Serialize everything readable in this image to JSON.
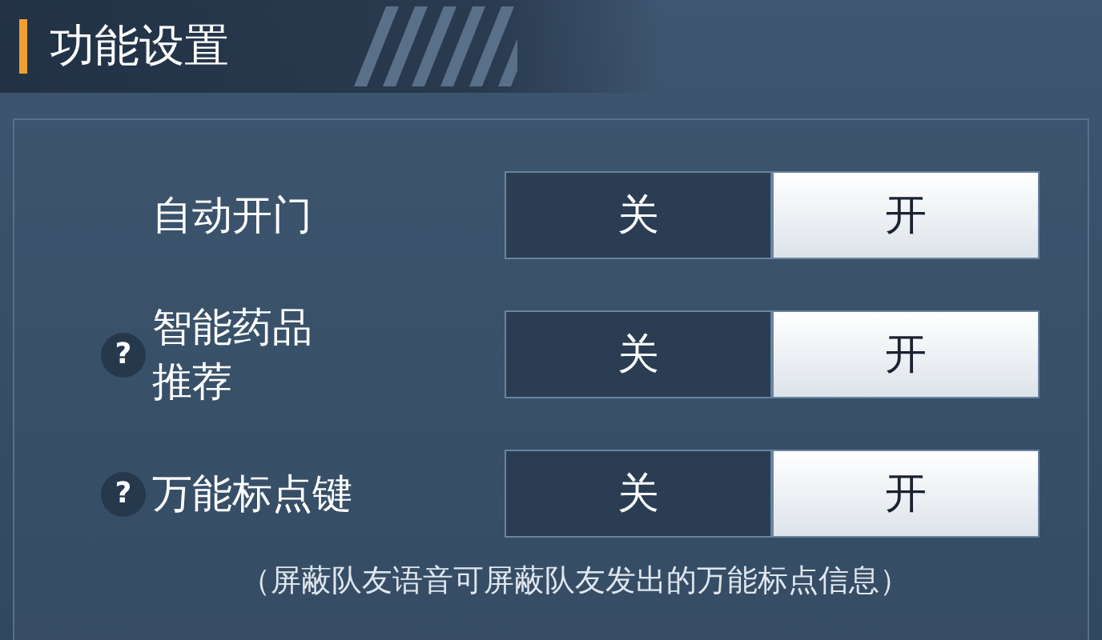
{
  "title": "功能设置",
  "settings": [
    {
      "label_lines": [
        "自动开门"
      ],
      "options": [
        {
          "label": "关",
          "selected": false
        },
        {
          "label": "开",
          "selected": true
        }
      ]
    },
    {
      "help_icon": "?",
      "label_lines": [
        "智能药品",
        "推荐"
      ],
      "options": [
        {
          "label": "关",
          "selected": false
        },
        {
          "label": "开",
          "selected": true
        }
      ]
    },
    {
      "help_icon": "?",
      "label_lines": [
        "万能标点键"
      ],
      "options": [
        {
          "label": "关",
          "selected": false
        },
        {
          "label": "开",
          "selected": true
        }
      ]
    }
  ],
  "note": "（屏蔽队友语音可屏蔽队友发出的万能标点信息）"
}
